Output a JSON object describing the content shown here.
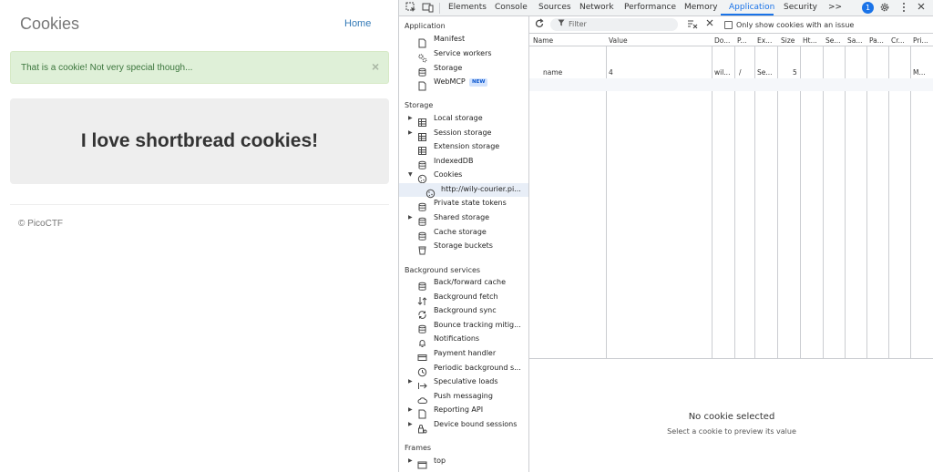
{
  "page": {
    "title": "Cookies",
    "nav_home": "Home",
    "alert_text": "That is a cookie! Not very special though...",
    "alert_close": "×",
    "jumbotron_text": "I love shortbread cookies!",
    "footer": "© PicoCTF"
  },
  "devtools": {
    "tabs": [
      "Elements",
      "Console",
      "Sources",
      "Network",
      "Performance",
      "Memory",
      "Application",
      "Security"
    ],
    "active_tab": "Application",
    "more_tabs": ">>",
    "badge": "1",
    "sidebar": {
      "sections": {
        "application": "Application",
        "storage": "Storage",
        "background": "Background services",
        "frames": "Frames"
      },
      "application_items": [
        "Manifest",
        "Service workers",
        "Storage",
        "WebMCP"
      ],
      "new_badge": "NEW",
      "storage_items": [
        "Local storage",
        "Session storage",
        "Extension storage",
        "IndexedDB",
        "Cookies",
        "http://wily-courier.pi...",
        "Private state tokens",
        "Shared storage",
        "Cache storage",
        "Storage buckets"
      ],
      "background_items": [
        "Back/forward cache",
        "Background fetch",
        "Background sync",
        "Bounce tracking mitig...",
        "Notifications",
        "Payment handler",
        "Periodic background s...",
        "Speculative loads",
        "Push messaging",
        "Reporting API",
        "Device bound sessions"
      ],
      "frames_items": [
        "top"
      ]
    },
    "cookies": {
      "filter_placeholder": "Filter",
      "only_issues_label": "Only show cookies with an issue",
      "columns": [
        "Name",
        "Value",
        "Do...",
        "P...",
        "Ex...",
        "Size",
        "Ht...",
        "Se...",
        "Sa...",
        "Pa...",
        "Cr...",
        "Pri..."
      ],
      "rows": [
        {
          "name": "name",
          "value": "4",
          "domain": "wil...",
          "path": "/",
          "expires": "Se...",
          "size": "5",
          "priority": "M..."
        }
      ],
      "preview_title": "No cookie selected",
      "preview_subtitle": "Select a cookie to preview its value"
    }
  }
}
